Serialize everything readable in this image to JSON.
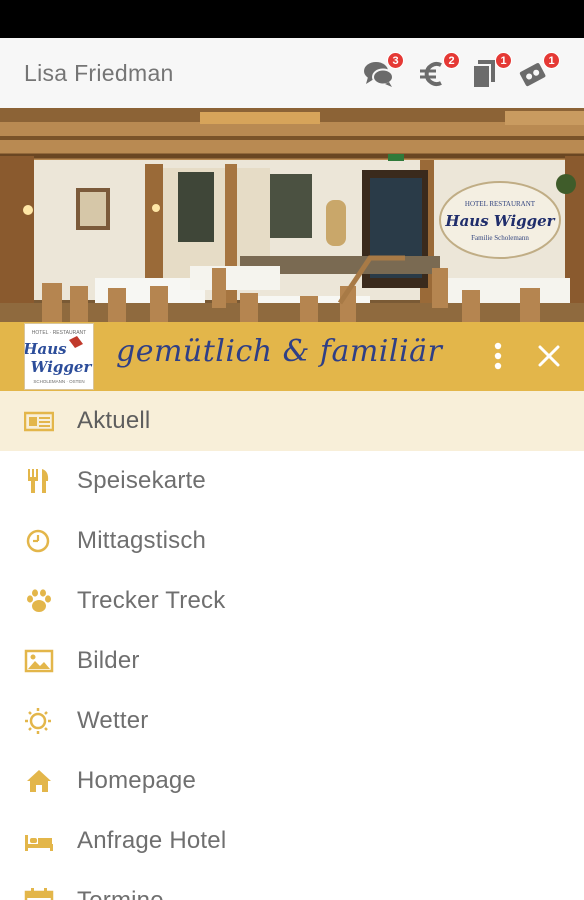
{
  "header": {
    "user_name": "Lisa Friedman",
    "actions": [
      {
        "name": "chat-icon",
        "badge": "3"
      },
      {
        "name": "euro-icon",
        "badge": "2"
      },
      {
        "name": "coupon-icon",
        "badge": "1"
      },
      {
        "name": "stamp-card-icon",
        "badge": "1"
      }
    ]
  },
  "hero": {
    "sign_line1": "HOTEL RESTAURANT",
    "sign_line2": "Haus Wigger",
    "sign_line3": "Familie Scholemann"
  },
  "banner": {
    "slogan": "gemütlich & familiär",
    "logo_top": "HOTEL · RESTAURANT",
    "logo_word1": "Haus",
    "logo_word2": "Wigger",
    "logo_sub": "SCHOLEMANN · OSTEN",
    "accent_color": "#e3b64a",
    "slogan_color": "#2f3f86"
  },
  "menu": {
    "icon_color": "#e3b64a",
    "items": [
      {
        "label": "Aktuell",
        "icon": "newspaper-icon",
        "active": true
      },
      {
        "label": "Speisekarte",
        "icon": "cutlery-icon"
      },
      {
        "label": "Mittagstisch",
        "icon": "clock-icon"
      },
      {
        "label": "Trecker Treck",
        "icon": "paw-icon"
      },
      {
        "label": "Bilder",
        "icon": "image-icon"
      },
      {
        "label": "Wetter",
        "icon": "sun-icon"
      },
      {
        "label": "Homepage",
        "icon": "home-icon"
      },
      {
        "label": "Anfrage Hotel",
        "icon": "bed-icon"
      },
      {
        "label": "Termine",
        "icon": "calendar-icon"
      }
    ]
  }
}
